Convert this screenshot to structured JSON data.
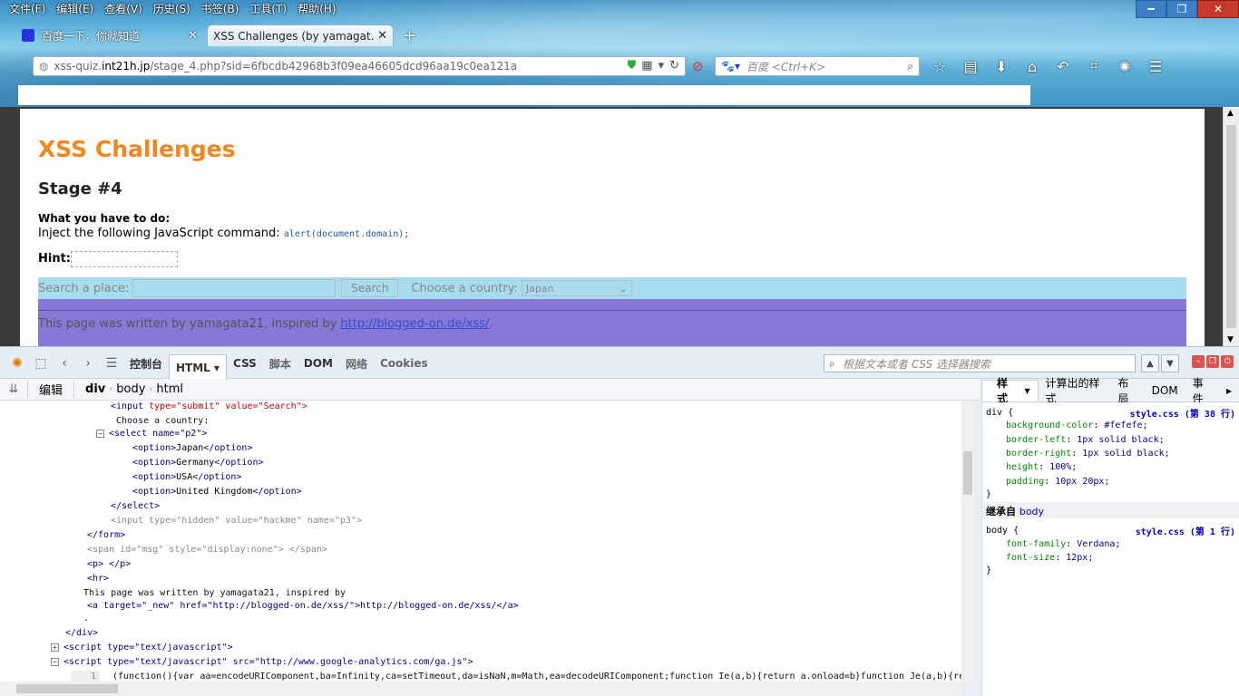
{
  "menubar": [
    "文件(F)",
    "编辑(E)",
    "查看(V)",
    "历史(S)",
    "书签(B)",
    "工具(T)",
    "帮助(H)"
  ],
  "tabs": [
    {
      "label": "百度一下，你就知道",
      "active": false
    },
    {
      "label": "XSS Challenges (by yamagat...",
      "active": true
    }
  ],
  "url": {
    "domain": "xss-quiz.int21h.jp",
    "rest": "/stage_4.php?sid=6fbcdb42968b3f09ea46605dcd96aa19c0ea121a",
    "prefix": "xss-quiz."
  },
  "search_placeholder": "百度 <Ctrl+K>",
  "page": {
    "title": "XSS Challenges",
    "stage": "Stage #4",
    "what_label": "What you have to do:",
    "inject_text": "Inject the following JavaScript command:",
    "inject_code": "alert(document.domain);",
    "hint_label": "Hint:",
    "search_label": "Search a place:",
    "search_button": "Search",
    "country_label": "Choose a country:",
    "country_selected": "Japan",
    "footer_text": "This page was written by yamagata21, inspired by ",
    "footer_link": "http://blogged-on.de/xss/",
    "footer_end": "."
  },
  "firebug": {
    "tabs": [
      "控制台",
      "HTML",
      "CSS",
      "脚本",
      "DOM",
      "网络",
      "Cookies"
    ],
    "search_placeholder": "根据文本或者 CSS 选择器搜索",
    "edit_label": "编辑",
    "crumbs": [
      "div",
      "body",
      "html"
    ],
    "side_tabs": [
      "样式",
      "计算出的样式",
      "布局",
      "DOM",
      "事件"
    ],
    "rule1_selector": "div {",
    "rule1_source": "style.css (第 38 行)",
    "rule1_props": [
      {
        "p": "background-color",
        "v": "#fefefe;"
      },
      {
        "p": "border-left",
        "v": "1px solid black;"
      },
      {
        "p": "border-right",
        "v": "1px solid black;"
      },
      {
        "p": "height",
        "v": "100%;"
      },
      {
        "p": "padding",
        "v": "10px 20px;"
      }
    ],
    "inherited_label": "继承自",
    "inherited_from": "body",
    "rule2_selector": "body {",
    "rule2_source": "style.css (第 1 行)",
    "rule2_props": [
      {
        "p": "font-family",
        "v": "Verdana;"
      },
      {
        "p": "font-size",
        "v": "12px;"
      }
    ],
    "close_brace": "}",
    "code": {
      "l1_tag": "<input",
      "l1_attrs": " type=\"submit\" value=\"Search\">",
      "l2": "Choose a country:",
      "l3": "<select name=\"p2\">",
      "opt1": "Japan",
      "opt2": "Germany",
      "opt3": "USA",
      "opt4": "United Kingdom",
      "l8": "</select>",
      "l9": "<input type=\"hidden\" value=\"hackme\" name=\"p3\">",
      "l10": "</form>",
      "l11": "<span id=\"msg\" style=\"display:none\"> </span>",
      "l12": "<p> </p>",
      "l13": "<hr>",
      "l14": "This page was written by yamagata21, inspired by",
      "l15": "<a target=\"_new\" href=\"http://blogged-on.de/xss/\">http://blogged-on.de/xss/</a>",
      "l16": ".",
      "l17": "</div>",
      "l18": "<script type=\"text/javascript\">",
      "l19": "<script type=\"text/javascript\" src=\"http://www.google-analytics.com/ga.js\">",
      "l20_num": "1",
      "l20": "(function(){var aa=encodeURIComponent,ba=Infinity,ca=setTimeout,da=isNaN,m=Math,ea=decodeURIComponent;function Ie(a,b){return a.onload=b}function Je(a,b){return a.onerror"
    }
  }
}
